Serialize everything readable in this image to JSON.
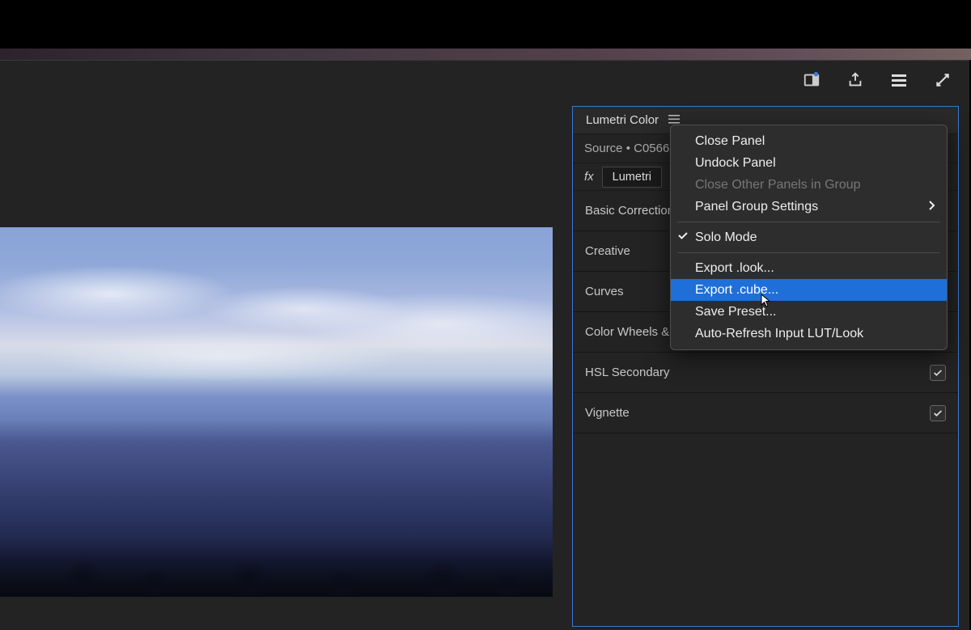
{
  "panel": {
    "title": "Lumetri Color",
    "source_label": "Source • C0566.",
    "fx_prefix": "fx",
    "fx_button": "Lumetri",
    "sections": [
      {
        "label": "Basic Correction",
        "checked": true
      },
      {
        "label": "Creative",
        "checked": true
      },
      {
        "label": "Curves",
        "checked": true
      },
      {
        "label": "Color Wheels &",
        "checked": true
      },
      {
        "label": "HSL Secondary",
        "checked": true
      },
      {
        "label": "Vignette",
        "checked": true
      }
    ]
  },
  "context_menu": {
    "items": [
      {
        "label": "Close Panel",
        "type": "item"
      },
      {
        "label": "Undock Panel",
        "type": "item"
      },
      {
        "label": "Close Other Panels in Group",
        "type": "item",
        "disabled": true
      },
      {
        "label": "Panel Group Settings",
        "type": "submenu"
      },
      {
        "type": "separator"
      },
      {
        "label": "Solo Mode",
        "type": "check",
        "checked": true
      },
      {
        "type": "separator"
      },
      {
        "label": "Export .look...",
        "type": "item"
      },
      {
        "label": "Export .cube...",
        "type": "item",
        "highlighted": true
      },
      {
        "label": "Save Preset...",
        "type": "item"
      },
      {
        "label": "Auto-Refresh Input LUT/Look",
        "type": "item"
      }
    ]
  },
  "toolbar_icons": {
    "workspace": "workspace-icon",
    "share": "share-icon",
    "menu": "menu-icon",
    "fullscreen": "fullscreen-icon"
  }
}
